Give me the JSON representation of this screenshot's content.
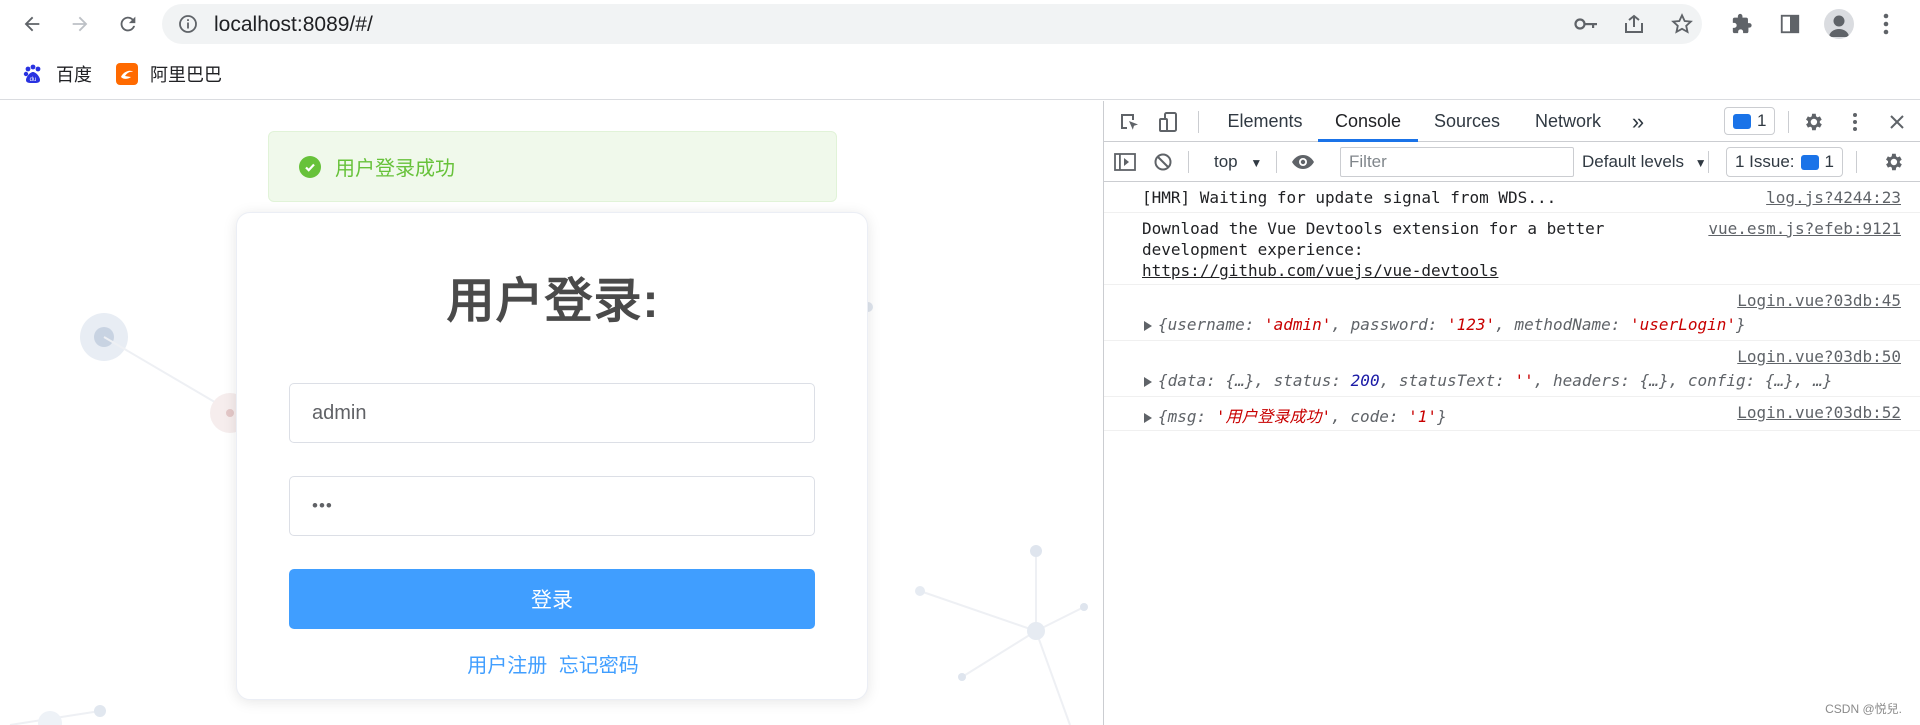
{
  "browser": {
    "url": "localhost:8089/#/",
    "bookmarks": [
      {
        "label": "百度",
        "icon": "baidu-icon"
      },
      {
        "label": "阿里巴巴",
        "icon": "alibaba-icon"
      }
    ]
  },
  "page": {
    "toast": {
      "message": "用户登录成功"
    },
    "login": {
      "title": "用户登录:",
      "username": "admin",
      "password": "•••",
      "login_button": "登录",
      "register_link": "用户注册",
      "forgot_link": "忘记密码"
    }
  },
  "devtools": {
    "tabs": [
      "Elements",
      "Console",
      "Sources",
      "Network"
    ],
    "active_tab": "Console",
    "more_tabs": "»",
    "messages_badge": "1",
    "context": "top",
    "filter_placeholder": "Filter",
    "levels": "Default levels",
    "issues": {
      "label": "1 Issue:",
      "count": "1"
    },
    "console_messages": [
      {
        "text": "[HMR] Waiting for update signal from WDS...",
        "source": "log.js?4244:23"
      },
      {
        "text_line1": "Download the Vue Devtools extension for a better",
        "text_line2": "development experience:",
        "link": "https://github.com/vuejs/vue-devtools",
        "source": "vue.esm.js?efeb:9121"
      },
      {
        "source": "Login.vue?03db:45",
        "obj": {
          "k1": "username",
          "v1": "'admin'",
          "k2": "password",
          "v2": "'123'",
          "k3": "methodName",
          "v3": "'userLogin'"
        }
      },
      {
        "source": "Login.vue?03db:50",
        "obj": {
          "k1": "data",
          "v1": "{…}",
          "k2": "status",
          "v2": "200",
          "k3": "statusText",
          "v3": "''",
          "k4": "headers",
          "v4": "{…}",
          "k5": "config",
          "v5": "{…}",
          "rest": "…"
        }
      },
      {
        "source": "Login.vue?03db:52",
        "obj": {
          "k1": "msg",
          "v1": "'用户登录成功'",
          "k2": "code",
          "v2": "'1'"
        }
      }
    ],
    "watermark": "CSDN @悦兒."
  },
  "colors": {
    "success": "#67c23a",
    "primary": "#409eff",
    "devtools_accent": "#1a73e8"
  }
}
